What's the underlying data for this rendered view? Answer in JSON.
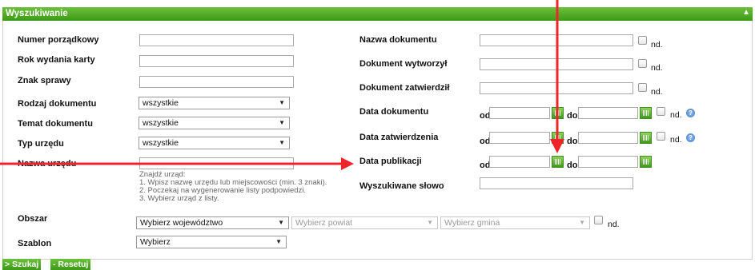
{
  "panel": {
    "title": "Wyszukiwanie",
    "collapse_icon": "▲"
  },
  "left": {
    "numer_porzadkowy": "Numer porządkowy",
    "rok_wydania": "Rok wydania karty",
    "znak_sprawy": "Znak sprawy",
    "rodzaj_dokumentu": "Rodzaj dokumentu",
    "temat_dokumentu": "Temat dokumentu",
    "typ_urzedu": "Typ urzędu",
    "nazwa_urzedu": "Nazwa urzędu",
    "select_all": "wszystkie",
    "hint": [
      "Znajdź urząd:",
      "1. Wpisz nazwę urzędu lub miejscowości (min. 3 znaki).",
      "2. Poczekaj na wygenerowanie listy podpowiedzi.",
      "3. Wybierz urząd z listy."
    ]
  },
  "right": {
    "nazwa_dokumentu": "Nazwa dokumentu",
    "dokument_wytworzyl": "Dokument wytworzył",
    "dokument_zatwierdzil": "Dokument zatwierdził",
    "data_dokumentu": "Data dokumentu",
    "data_zatwierdzenia": "Data zatwierdzenia",
    "data_publikacji": "Data publikacji",
    "wyszukiwane_slowo": "Wyszukiwane słowo",
    "od": "od",
    "do": "do",
    "nd": "nd.",
    "help": "?"
  },
  "obszar": {
    "label": "Obszar",
    "wojewodztwo": "Wybierz województwo",
    "powiat": "Wybierz powiat",
    "gmina": "Wybierz gmina",
    "nd": "nd."
  },
  "szablon": {
    "label": "Szablon",
    "value": "Wybierz"
  },
  "buttons": {
    "search": "> Szukaj",
    "reset": "- Resetuj"
  },
  "colors": {
    "header_green": "#4aa722",
    "annotation_red": "#f0252b"
  }
}
